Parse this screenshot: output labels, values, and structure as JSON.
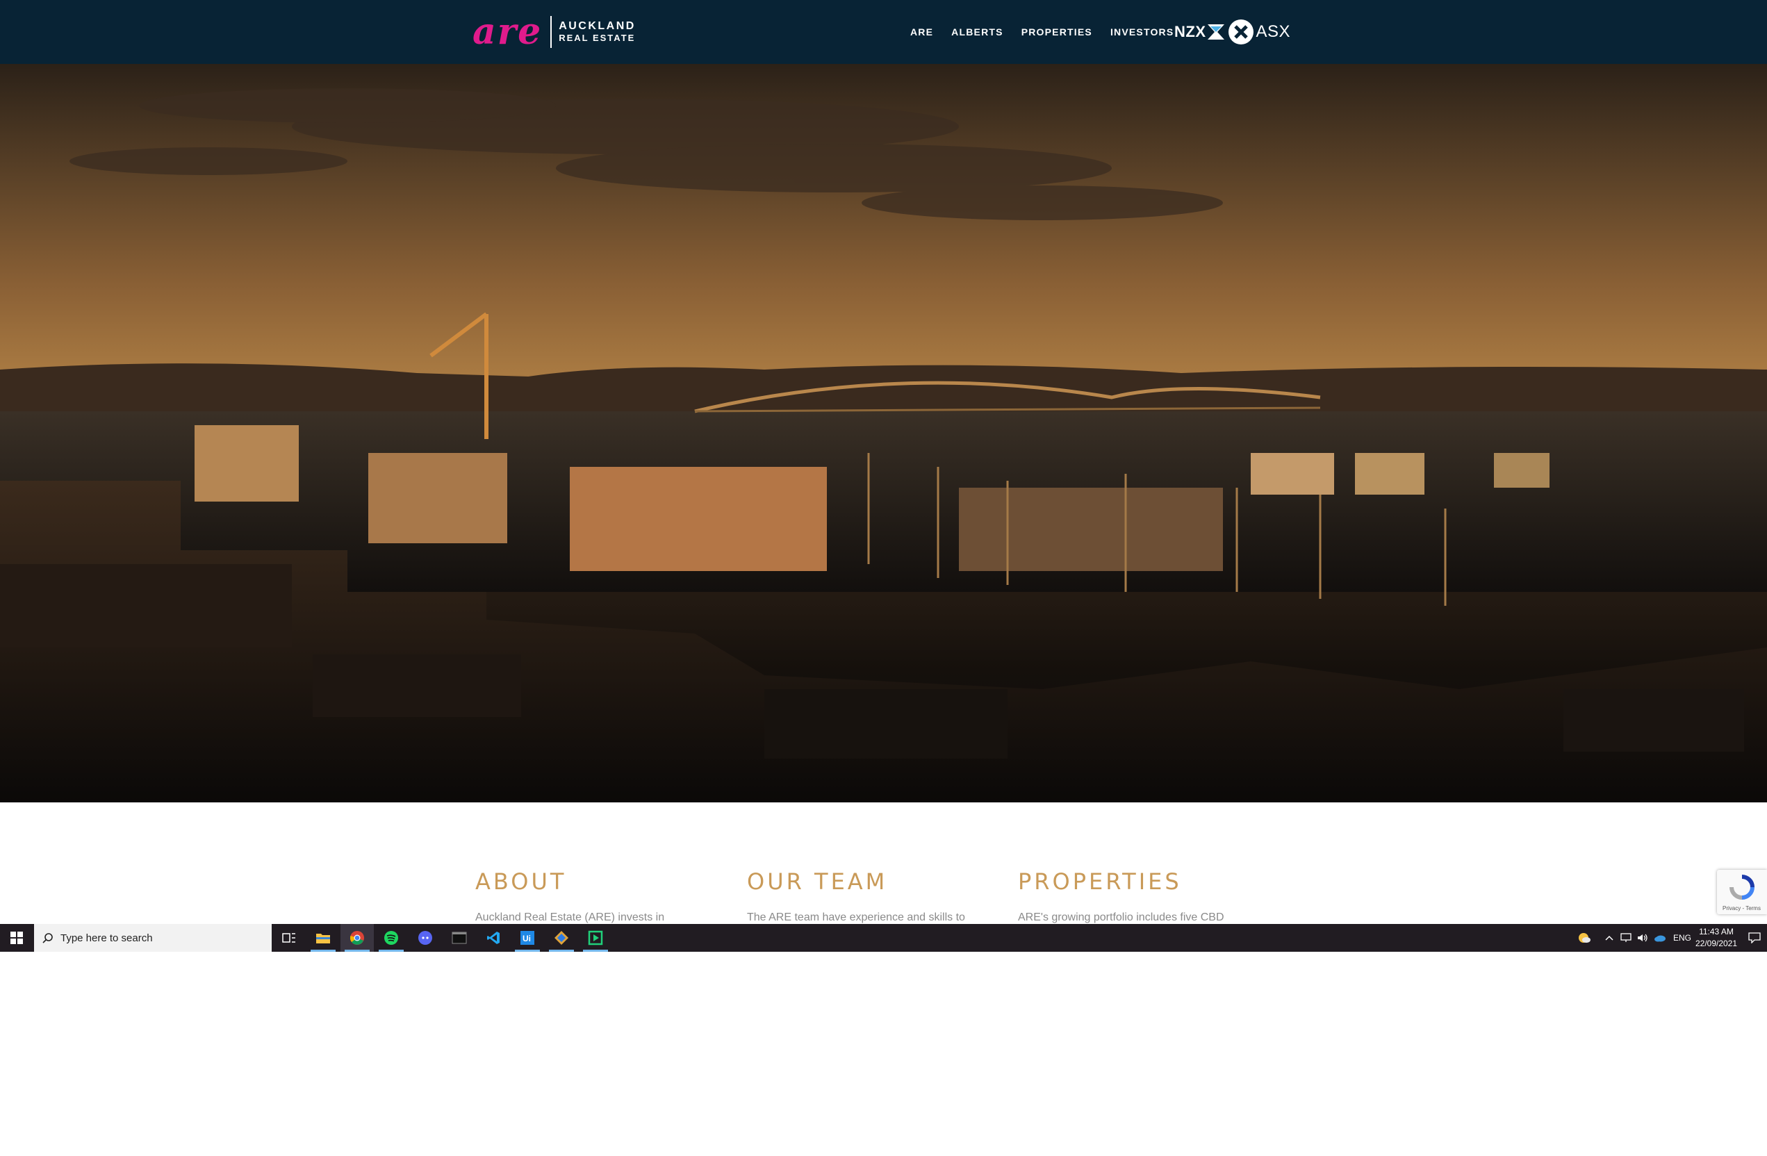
{
  "header": {
    "logo_script": "are",
    "logo_line1": "AUCKLAND",
    "logo_line2": "REAL ESTATE",
    "nav": [
      {
        "label": "ARE"
      },
      {
        "label": "ALBERTS"
      },
      {
        "label": "PROPERTIES"
      },
      {
        "label": "INVESTORS"
      }
    ],
    "exchange_nzx": "NZX",
    "exchange_asx": "ASX"
  },
  "sections": [
    {
      "title": "ABOUT",
      "text": "Auckland Real Estate (ARE) invests in"
    },
    {
      "title": "OUR TEAM",
      "text": "The ARE team have experience and skills to"
    },
    {
      "title": "PROPERTIES",
      "text": "ARE's growing portfolio includes five CBD"
    }
  ],
  "recaptcha": {
    "links": "Privacy - Terms"
  },
  "taskbar": {
    "search_placeholder": "Type here to search",
    "apps": [
      "task-view",
      "file-explorer",
      "chrome",
      "spotify",
      "discord",
      "terminal",
      "vscode",
      "uipath",
      "git-kraken",
      "app-green"
    ],
    "tray_language": "ENG",
    "time": "11:43 AM",
    "date": "22/09/2021"
  },
  "colors": {
    "header_bg": "#082335",
    "logo_pink": "#e01b8c",
    "section_title": "#c99a58",
    "taskbar_bg": "#211c22"
  }
}
